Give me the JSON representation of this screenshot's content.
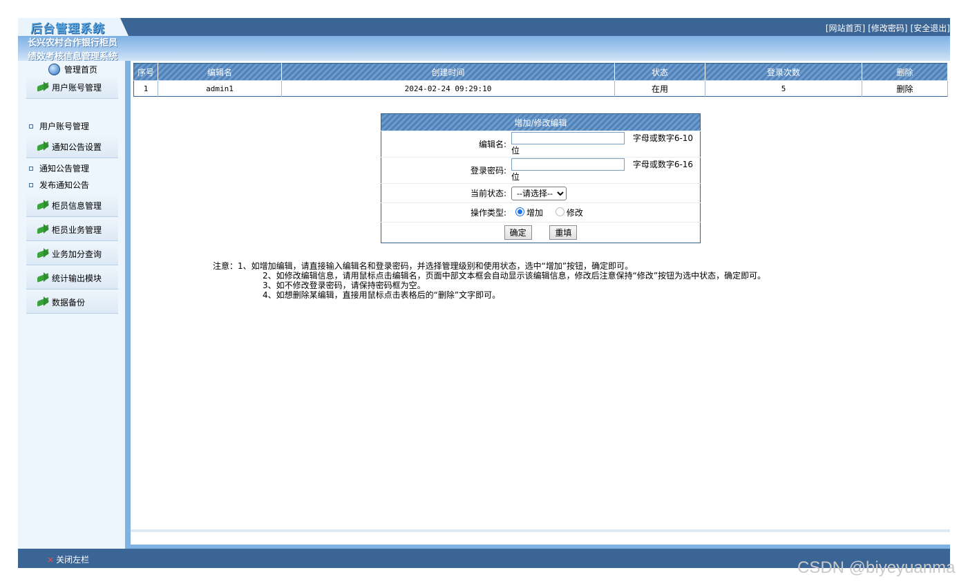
{
  "header": {
    "logo_text": "后台管理系统",
    "links": [
      "[网站首页]",
      "[修改密码]",
      "[安全退出]"
    ]
  },
  "sidebar": {
    "system_name_line1": "长兴农村合作银行柜员",
    "system_name_line2": "绩效考核信息管理系统",
    "home_label": "管理首页",
    "menus": [
      {
        "label": "用户账号管理",
        "subitems": [
          "用户账号管理"
        ]
      },
      {
        "label": "通知公告设置",
        "subitems": [
          "通知公告管理",
          "发布通知公告"
        ]
      },
      {
        "label": "柜员信息管理",
        "subitems": []
      },
      {
        "label": "柜员业务管理",
        "subitems": []
      },
      {
        "label": "业务加分查询",
        "subitems": []
      },
      {
        "label": "统计输出模块",
        "subitems": []
      },
      {
        "label": "数据备份",
        "subitems": []
      }
    ]
  },
  "table": {
    "headers": [
      "序号",
      "编辑名",
      "创建时间",
      "状态",
      "登录次数",
      "删除"
    ],
    "rows": [
      [
        "1",
        "admin1",
        "2024-02-24 09:29:10",
        "在用",
        "5",
        "删除"
      ]
    ]
  },
  "form": {
    "title": "增加/修改编辑",
    "name_label": "编辑名:",
    "name_value": "",
    "name_hint": "字母或数字6-10位",
    "password_label": "登录密码:",
    "password_value": "",
    "password_hint": "字母或数字6-16位",
    "status_label": "当前状态:",
    "status_selected": "--请选择--",
    "op_label": "操作类型:",
    "op_add": "增加",
    "op_modify": "修改",
    "op_selected": "增加",
    "submit_label": "确定",
    "reset_label": "重填"
  },
  "notes": {
    "line1": "注意：1、如增加编辑，请直接输入编辑名和登录密码，并选择管理级别和使用状态，选中“增加”按钮，确定即可。",
    "line2": "2、如修改编辑信息，请用鼠标点击编辑名，页面中部文本框会自动显示该编辑信息，修改后注意保持“修改”按钮为选中状态，确定即可。",
    "line3": "3、如不修改登录密码，请保持密码框为空。",
    "line4": "4、如想删除某编辑，直接用鼠标点击表格后的“删除”文字即可。"
  },
  "footer": {
    "close_label": "关闭左栏"
  },
  "watermark": "CSDN @biyeyuanma",
  "colors": {
    "topbar": "#3b6595",
    "accent": "#7fb1e3",
    "sidebar_bg": "#eef6fd"
  }
}
